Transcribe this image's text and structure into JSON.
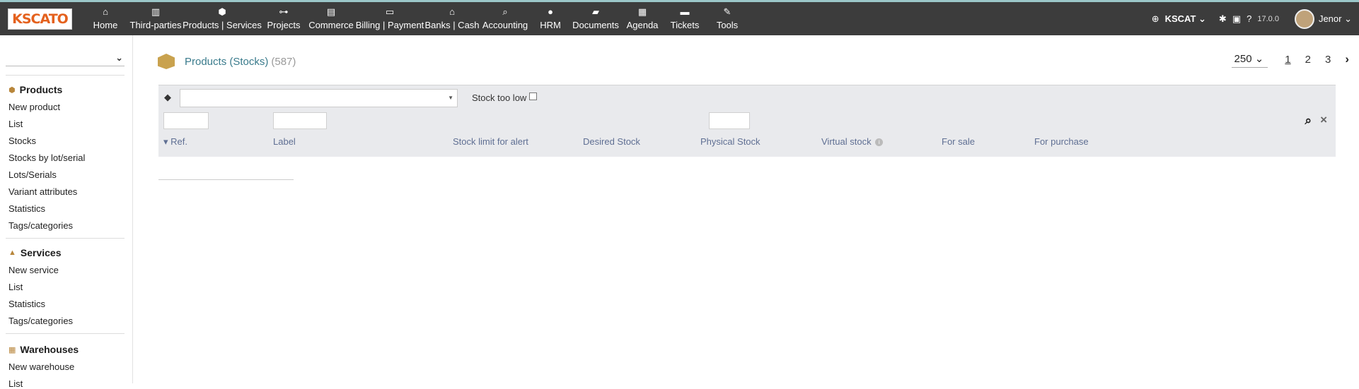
{
  "app": {
    "logo_text": "KSCATO",
    "entity": "KSCAT",
    "version": "17.0.0",
    "user": "Jenor"
  },
  "menu": [
    {
      "label": "Home",
      "icon": "home-icon",
      "glyph": "⌂"
    },
    {
      "label": "Third-parties",
      "icon": "building-icon",
      "glyph": "▥"
    },
    {
      "label": "Products | Services",
      "icon": "cube-icon",
      "glyph": "⬢"
    },
    {
      "label": "Projects",
      "icon": "sitemap-icon",
      "glyph": "⊶"
    },
    {
      "label": "Commerce",
      "icon": "briefcase-icon",
      "glyph": "▤"
    },
    {
      "label": "Billing | Payment",
      "icon": "money-icon",
      "glyph": "▭"
    },
    {
      "label": "Banks | Cash",
      "icon": "bank-icon",
      "glyph": "⌂"
    },
    {
      "label": "Accounting",
      "icon": "search-dollar-icon",
      "glyph": "⌕"
    },
    {
      "label": "HRM",
      "icon": "user-icon",
      "glyph": "●"
    },
    {
      "label": "Documents",
      "icon": "folder-icon",
      "glyph": "▰"
    },
    {
      "label": "Agenda",
      "icon": "calendar-icon",
      "glyph": "▦"
    },
    {
      "label": "Tickets",
      "icon": "ticket-icon",
      "glyph": "▬"
    },
    {
      "label": "Tools",
      "icon": "wrench-icon",
      "glyph": "✎"
    }
  ],
  "sidebar": {
    "sections": [
      {
        "title": "Products",
        "icon": "cube-icon",
        "items": [
          "New product",
          "List",
          "Stocks",
          "Stocks by lot/serial",
          "Lots/Serials",
          "Variant attributes",
          "Statistics",
          "Tags/categories"
        ]
      },
      {
        "title": "Services",
        "icon": "concierge-bell-icon",
        "items": [
          "New service",
          "List",
          "Statistics",
          "Tags/categories"
        ]
      },
      {
        "title": "Warehouses",
        "icon": "boxes-icon",
        "items": [
          "New warehouse",
          "List"
        ]
      }
    ]
  },
  "page": {
    "title": "Products (Stocks)",
    "count": "(587)",
    "limit": "250",
    "pages": [
      "1",
      "2",
      "3"
    ],
    "current_page": "1"
  },
  "filters": {
    "stock_too_low_label": "Stock too low",
    "stock_too_low_checked": false
  },
  "table": {
    "columns": [
      "Ref.",
      "Label",
      "Stock limit for alert",
      "Desired Stock",
      "Physical Stock",
      "Virtual stock",
      "For sale",
      "For purchase"
    ],
    "sort_column": "Ref.",
    "rows": []
  },
  "colors": {
    "topbar": "#3c3c3c",
    "title": "#3a7b8c",
    "column_header": "#5f6f93",
    "filter_bg": "#e9eaed"
  }
}
